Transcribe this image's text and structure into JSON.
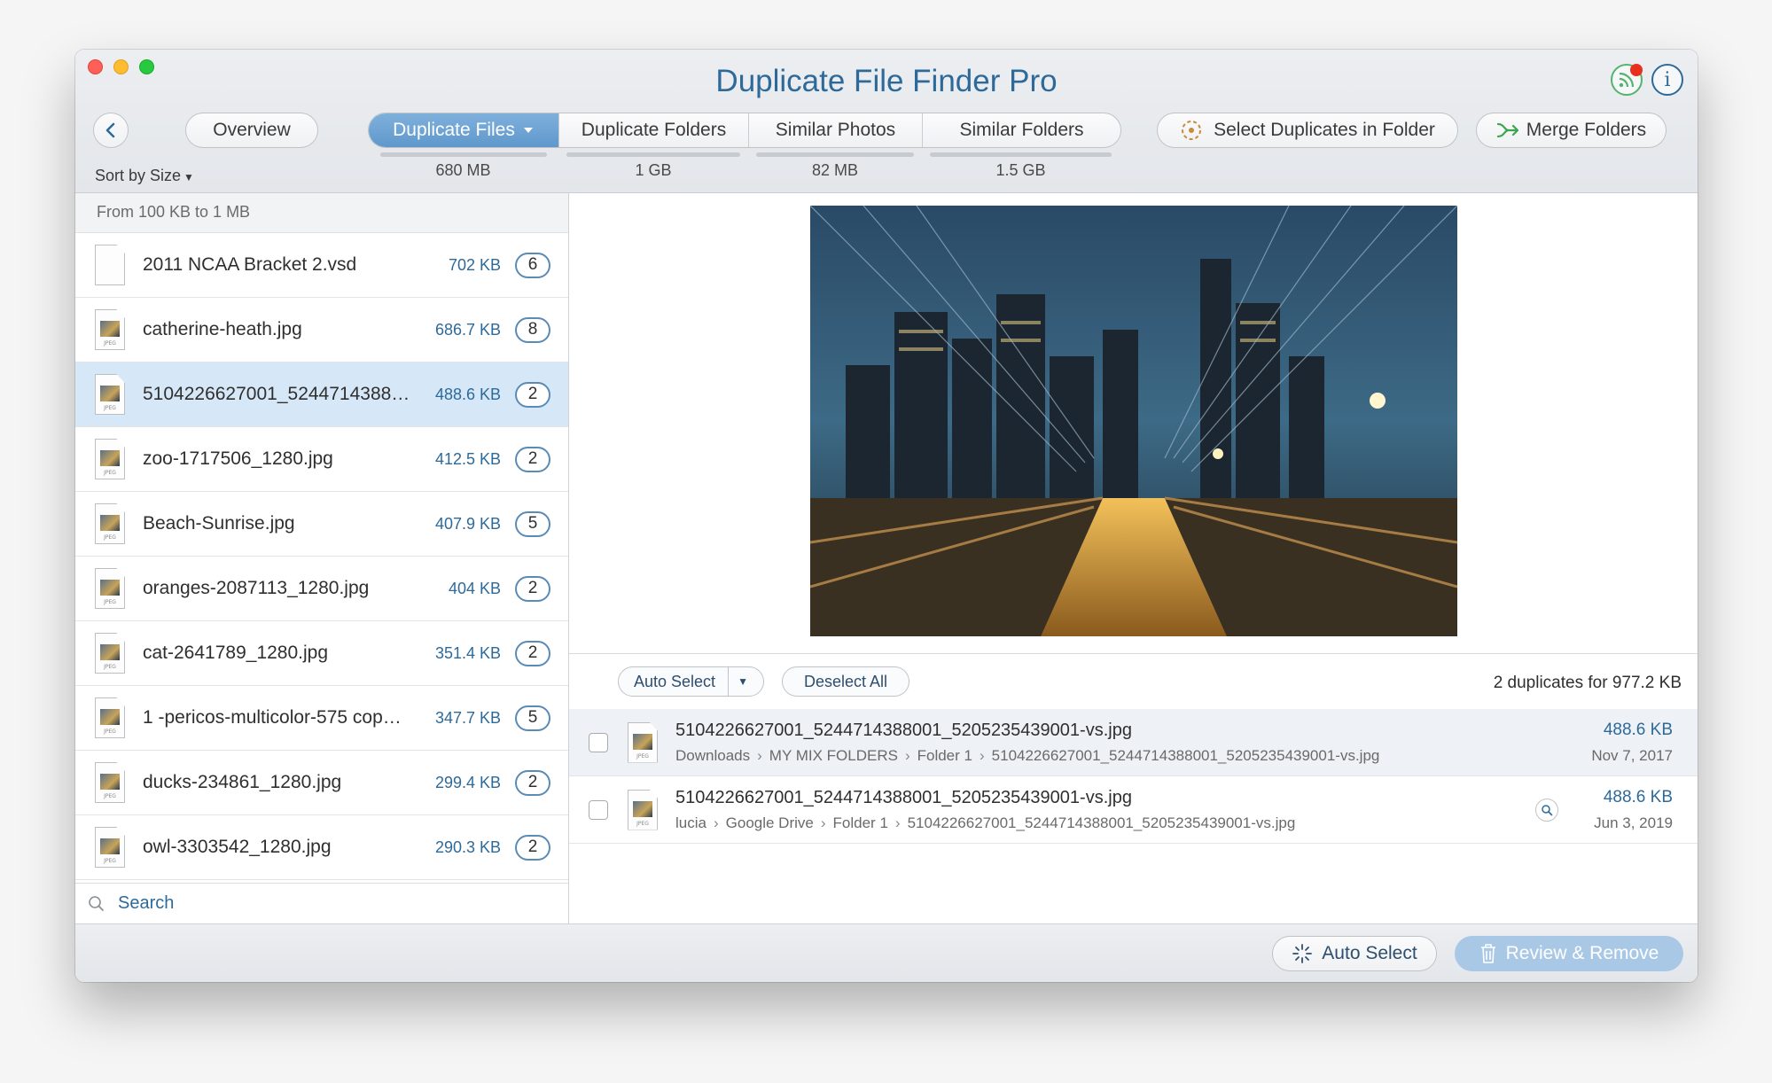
{
  "app": {
    "title": "Duplicate File Finder Pro"
  },
  "toolbar": {
    "overview_label": "Overview",
    "tabs": [
      {
        "label": "Duplicate Files",
        "size": "680 MB",
        "active": true
      },
      {
        "label": "Duplicate Folders",
        "size": "1 GB",
        "active": false
      },
      {
        "label": "Similar Photos",
        "size": "82 MB",
        "active": false
      },
      {
        "label": "Similar Folders",
        "size": "1.5 GB",
        "active": false
      }
    ],
    "select_duplicates_label": "Select Duplicates in Folder",
    "merge_folders_label": "Merge Folders",
    "sort_label": "Sort by Size"
  },
  "sidebar": {
    "group_header": "From 100 KB to 1 MB",
    "files": [
      {
        "name": "2011 NCAA Bracket 2.vsd",
        "size": "702 KB",
        "count": "6",
        "icon": "document-icon"
      },
      {
        "name": "catherine-heath.jpg",
        "size": "686.7 KB",
        "count": "8",
        "icon": "jpeg-icon"
      },
      {
        "name": "5104226627001_5244714388…",
        "size": "488.6 KB",
        "count": "2",
        "icon": "jpeg-icon",
        "selected": true
      },
      {
        "name": "zoo-1717506_1280.jpg",
        "size": "412.5 KB",
        "count": "2",
        "icon": "jpeg-icon"
      },
      {
        "name": "Beach-Sunrise.jpg",
        "size": "407.9 KB",
        "count": "5",
        "icon": "jpeg-icon"
      },
      {
        "name": "oranges-2087113_1280.jpg",
        "size": "404 KB",
        "count": "2",
        "icon": "jpeg-icon"
      },
      {
        "name": "cat-2641789_1280.jpg",
        "size": "351.4 KB",
        "count": "2",
        "icon": "jpeg-icon"
      },
      {
        "name": "1 -pericos-multicolor-575 cop…",
        "size": "347.7 KB",
        "count": "5",
        "icon": "jpeg-icon"
      },
      {
        "name": "ducks-234861_1280.jpg",
        "size": "299.4 KB",
        "count": "2",
        "icon": "jpeg-icon"
      },
      {
        "name": "owl-3303542_1280.jpg",
        "size": "290.3 KB",
        "count": "2",
        "icon": "jpeg-icon"
      }
    ],
    "search_placeholder": "Search"
  },
  "detail": {
    "auto_select_label": "Auto Select",
    "deselect_all_label": "Deselect All",
    "summary": "2 duplicates for 977.2 KB",
    "duplicates": [
      {
        "name": "5104226627001_5244714388001_5205235439001-vs.jpg",
        "path": [
          "Downloads",
          "MY MIX FOLDERS",
          "Folder 1",
          "5104226627001_5244714388001_5205235439001-vs.jpg"
        ],
        "size": "488.6 KB",
        "date": "Nov 7, 2017"
      },
      {
        "name": "5104226627001_5244714388001_5205235439001-vs.jpg",
        "path": [
          "lucia",
          "Google Drive",
          "Folder 1",
          "5104226627001_5244714388001_5205235439001-vs.jpg"
        ],
        "size": "488.6 KB",
        "date": "Jun 3, 2019"
      }
    ]
  },
  "bottom": {
    "auto_select_label": "Auto Select",
    "review_label": "Review & Remove"
  },
  "colors": {
    "accent": "#2d6a9a",
    "tab_active": "#6fa4d4",
    "selected_row": "#d6e8f8",
    "review_button": "#a9c8e6"
  }
}
